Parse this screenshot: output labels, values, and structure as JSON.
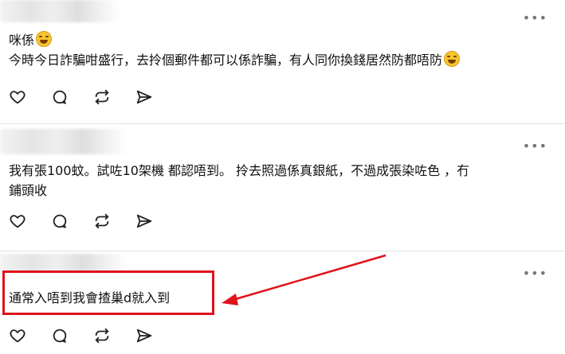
{
  "posts": [
    {
      "lines": [
        "咪係",
        "今時今日詐騙咁盛行，去拎個郵件都可以係詐騙，有人同你換錢居然防都唔防"
      ],
      "more_label": "•••"
    },
    {
      "lines": [
        "我有張100蚊。試咗10架機 都認唔到。 拎去照過係真銀紙，不過成張染咗色 ，冇",
        "鋪頭收"
      ],
      "more_label": "•••"
    },
    {
      "lines": [
        "通常入唔到我會揸巢d就入到"
      ],
      "more_label": "•••"
    }
  ],
  "icons": {
    "like": "heart-icon",
    "reply": "comment-icon",
    "repost": "repost-icon",
    "share": "send-icon",
    "emoji1": "rolling-laugh-emoji",
    "emoji2": "grinning-sweat-emoji"
  },
  "colors": {
    "highlight": "#e0121b",
    "text": "#111111",
    "divider": "#e3e3e3"
  }
}
